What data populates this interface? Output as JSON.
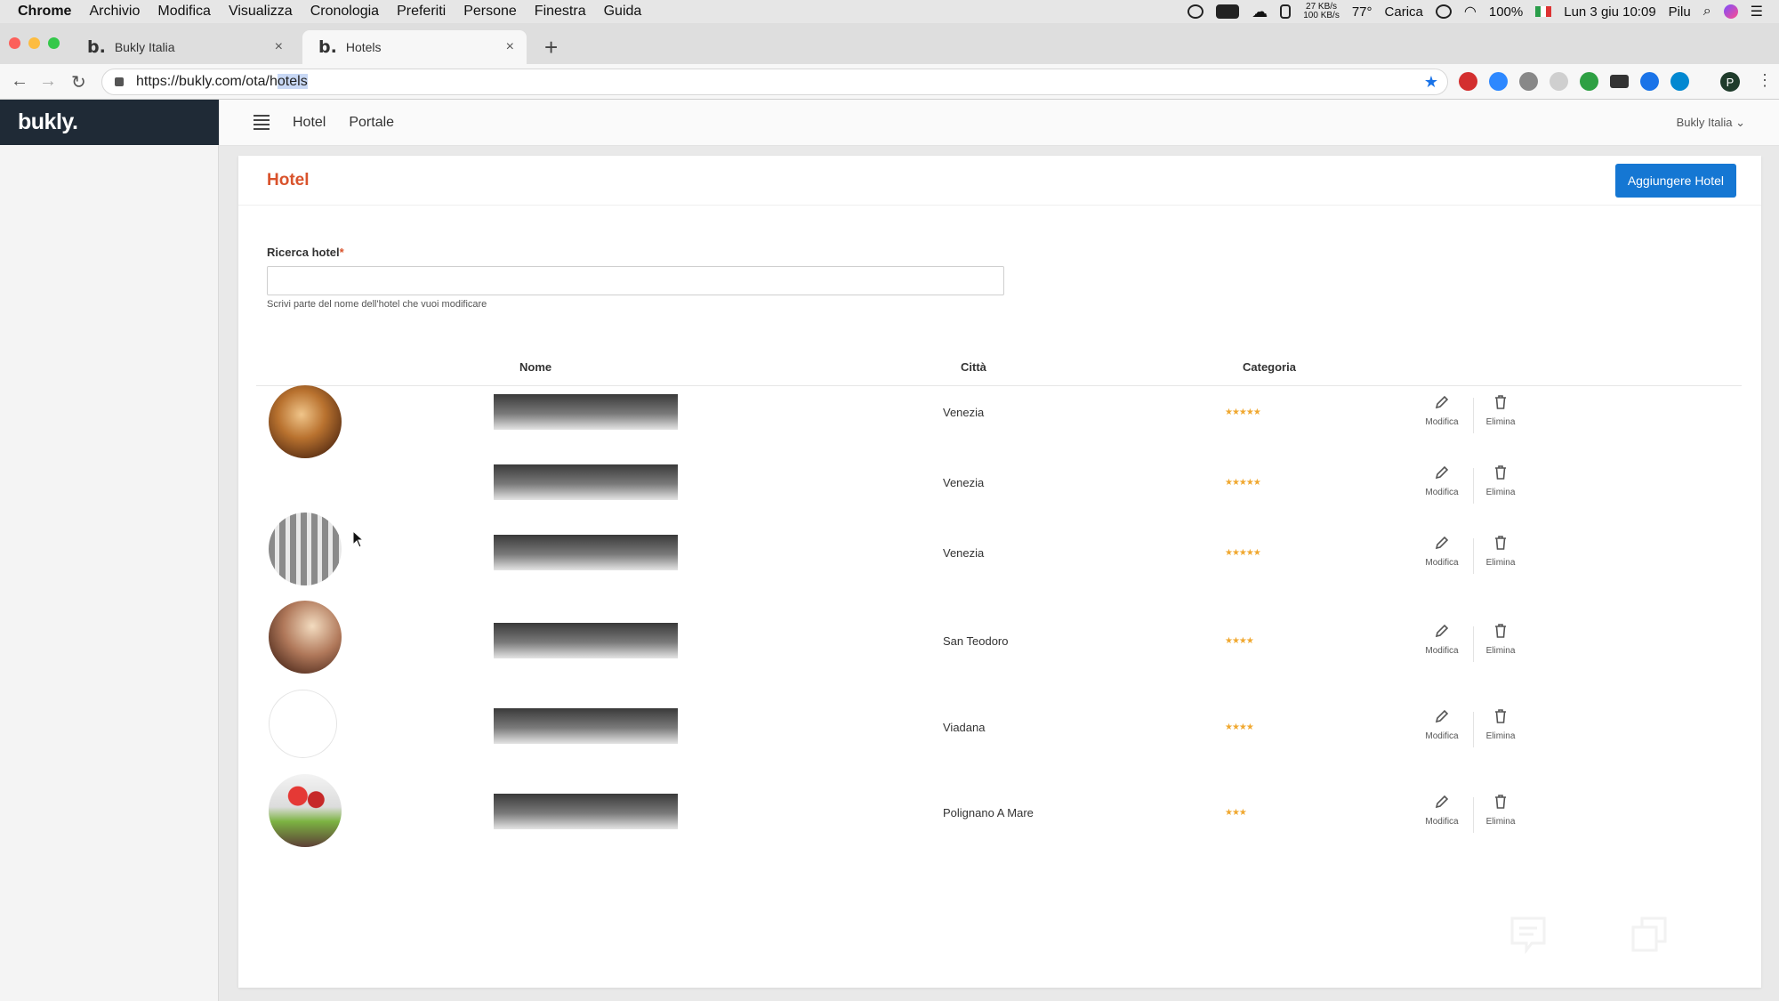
{
  "menubar": {
    "app": "Chrome",
    "items": [
      "Archivio",
      "Modifica",
      "Visualizza",
      "Cronologia",
      "Preferiti",
      "Persone",
      "Finestra",
      "Guida"
    ],
    "net_up": "27 KB/s",
    "net_down": "100 KB/s",
    "temp": "77°",
    "power": "Carica",
    "battery": "100%",
    "datetime": "Lun 3 giu 10:09",
    "user": "Pilu"
  },
  "tabs": [
    {
      "favicon": "b.",
      "title": "Bukly Italia",
      "close": "×"
    },
    {
      "favicon": "b.",
      "title": "Hotels",
      "close": "×"
    }
  ],
  "newtab": "+",
  "address": {
    "base": "https://bukly.com/ota/h",
    "selected": "otels"
  },
  "profile_initial": "P",
  "app": {
    "logo": "bukly.",
    "nav": [
      "Hotel",
      "Portale"
    ],
    "account": "Bukly Italia ⌄"
  },
  "page": {
    "title": "Hotel",
    "add_button": "Aggiungere Hotel",
    "search_label": "Ricerca hotel",
    "search_required": "*",
    "search_value": "",
    "search_help": "Scrivi parte del nome dell'hotel che vuoi modificare"
  },
  "table": {
    "headers": {
      "name": "Nome",
      "city": "Città",
      "category": "Categoria"
    },
    "edit_label": "Modifica",
    "delete_label": "Elimina",
    "rows": [
      {
        "image": "photo-lobby",
        "city": "Venezia",
        "stars": "★★★★★"
      },
      {
        "image": "none",
        "city": "Venezia",
        "stars": "★★★★★"
      },
      {
        "image": "photo-facade",
        "city": "Venezia",
        "stars": "★★★★★"
      },
      {
        "image": "photo-room",
        "city": "San Teodoro",
        "stars": "★★★★"
      },
      {
        "image": "empty",
        "city": "Viadana",
        "stars": "★★★★"
      },
      {
        "image": "photo-flowers",
        "city": "Polignano A Mare",
        "stars": "★★★"
      }
    ]
  },
  "colors": {
    "accent": "#d9532c",
    "primary": "#1577d3",
    "sidebar_logo_bg": "#1f2a36",
    "stars": "#f0a830"
  },
  "icons": [
    "pencil-icon",
    "trash-icon",
    "chat-icon",
    "window-icon",
    "star-icon",
    "hamburger-icon"
  ]
}
